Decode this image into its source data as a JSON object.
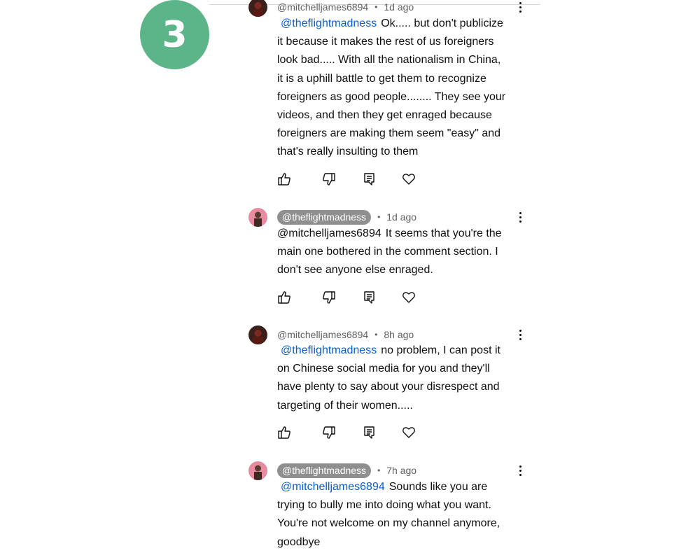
{
  "step_badge": {
    "number": "3",
    "color": "#5bb589"
  },
  "colors": {
    "mention": "#065fd4",
    "meta": "#606060",
    "pill": "#8f8f8f"
  },
  "comments": [
    {
      "author": "@mitchelljames6894",
      "author_style": "plain",
      "age": "1d ago",
      "mention": "@theflightmadness",
      "mention_linked": true,
      "lines": [
        "Ok..... but don't publicize",
        "it because it makes the rest of us foreigners",
        "look bad..... With all the nationalism in China,",
        "it is a uphill battle to get them to recognize",
        "foreigners as good people........  They see your",
        "videos, and then they get enraged because",
        "foreigners are making them seem \"easy\" and",
        "that's really insulting to them"
      ],
      "icons": [
        "thumbs-up-icon",
        "thumbs-down-icon",
        "reply-icon",
        "heart-icon",
        "more-vert-icon"
      ]
    },
    {
      "author": "@theflightmadness",
      "author_style": "pill",
      "age": "1d ago",
      "mention": "@mitchelljames6894",
      "mention_linked": false,
      "lines": [
        "It seems that you're the",
        "main one bothered in the comment section. I",
        "don't see anyone else enraged."
      ],
      "icons": [
        "thumbs-up-icon",
        "thumbs-down-icon",
        "reply-icon",
        "heart-icon",
        "more-vert-icon"
      ]
    },
    {
      "author": "@mitchelljames6894",
      "author_style": "plain",
      "age": "8h ago",
      "mention": "@theflightmadness",
      "mention_linked": true,
      "lines": [
        "no problem, I can post it",
        "on Chinese social media for you and they'll",
        "have plenty to say about your disrespect and",
        "targeting of their women....."
      ],
      "icons": [
        "thumbs-up-icon",
        "thumbs-down-icon",
        "reply-icon",
        "heart-icon",
        "more-vert-icon"
      ]
    },
    {
      "author": "@theflightmadness",
      "author_style": "pill",
      "age": "7h ago",
      "mention": "@mitchelljames6894",
      "mention_linked": true,
      "lines": [
        "Sounds like you are",
        "trying to bully me into doing what you want.",
        "You're not welcome on my channel anymore,",
        "goodbye"
      ],
      "icons": [
        "more-vert-icon"
      ]
    }
  ]
}
